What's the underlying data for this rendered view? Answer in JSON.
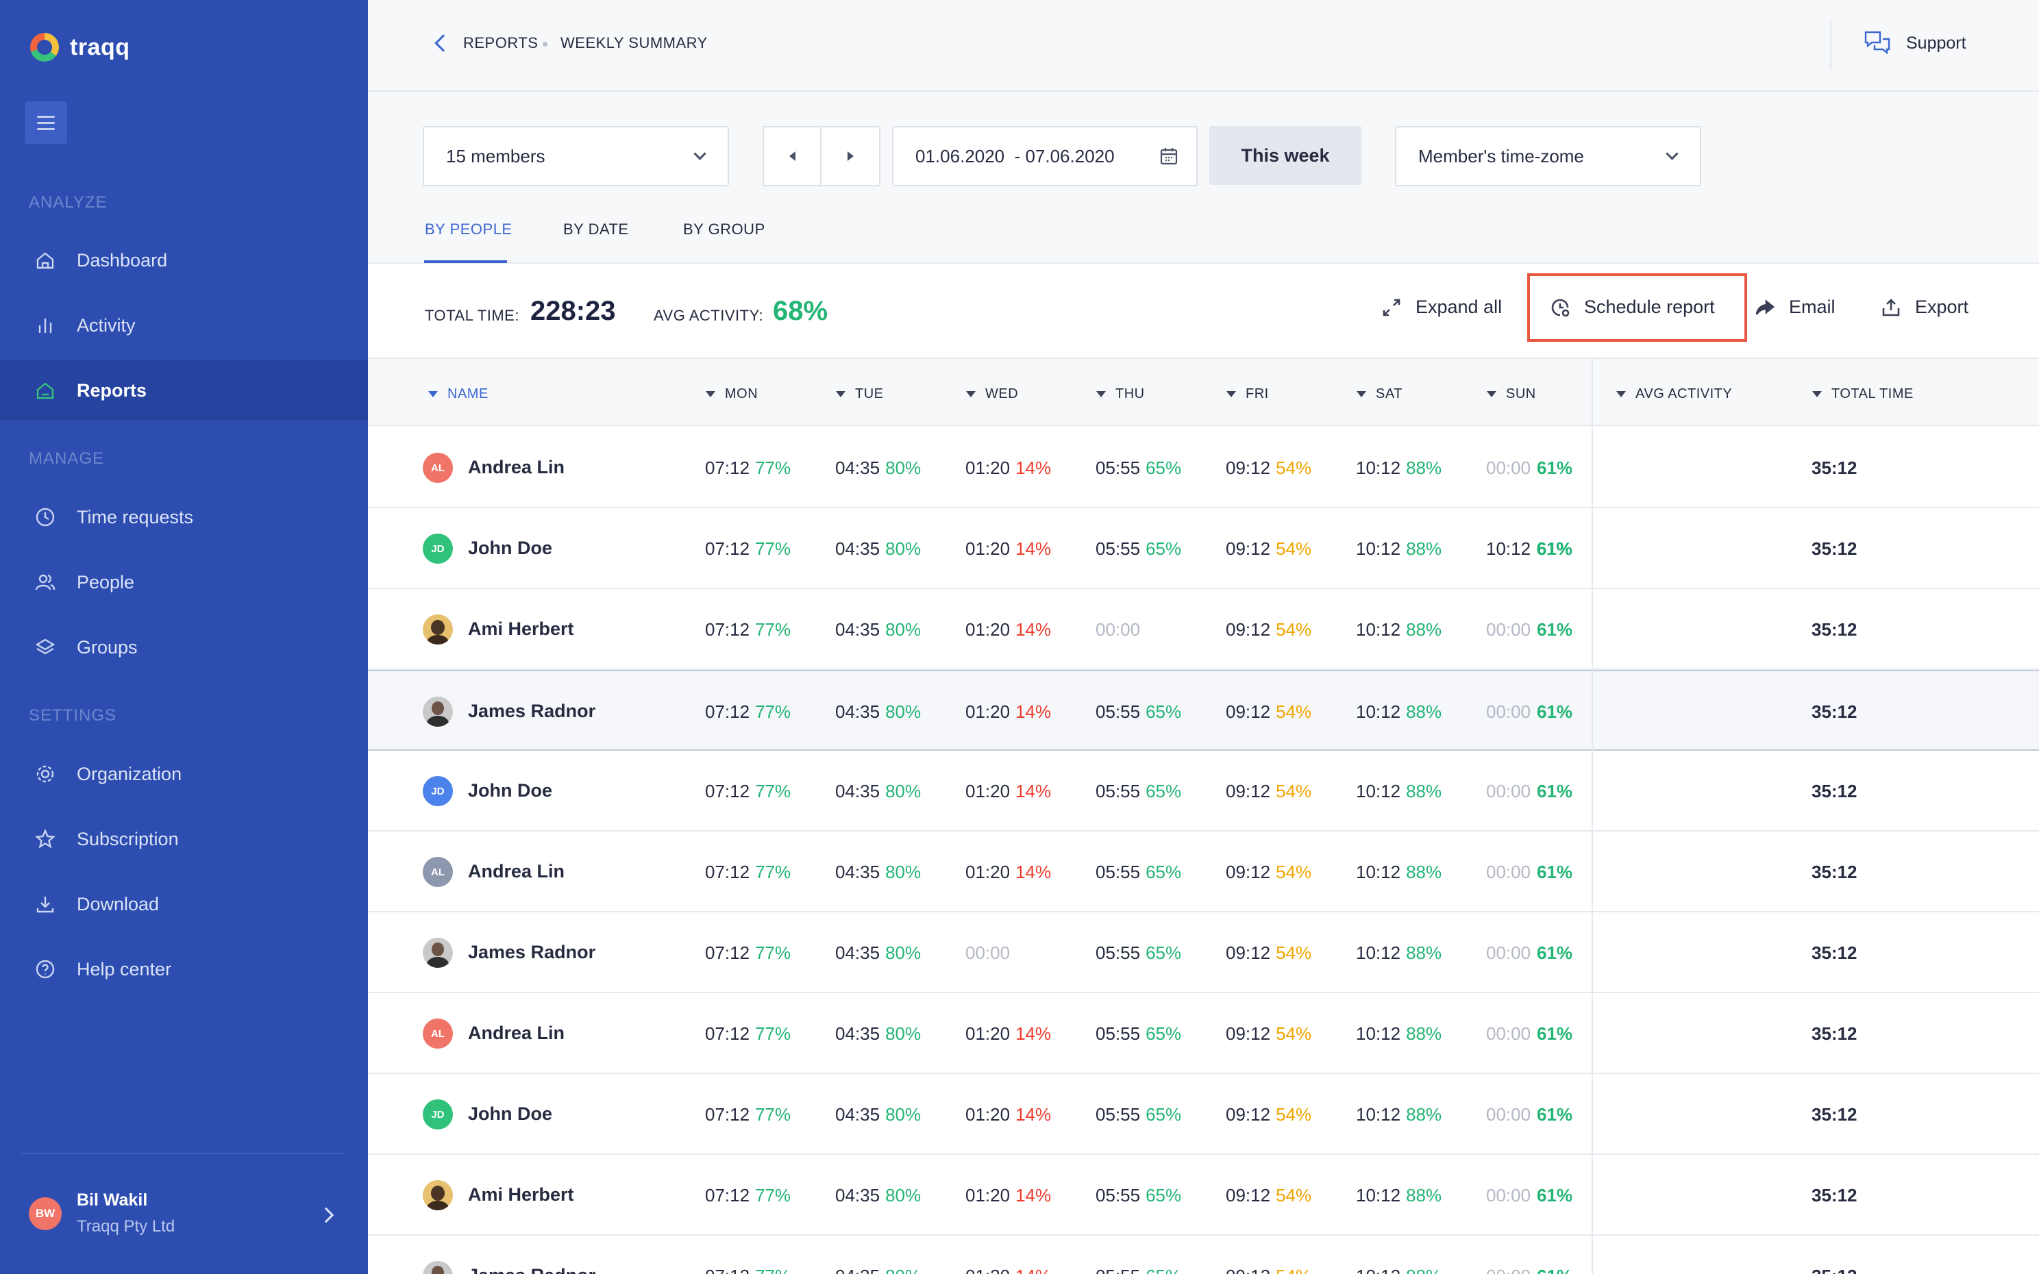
{
  "app": {
    "name": "traqq"
  },
  "sidebar": {
    "sections": [
      "ANALYZE",
      "MANAGE",
      "SETTINGS"
    ],
    "items": [
      {
        "label": "Dashboard",
        "icon": "home-icon"
      },
      {
        "label": "Activity",
        "icon": "bar-chart-icon"
      },
      {
        "label": "Reports",
        "icon": "reports-icon",
        "active": true
      },
      {
        "label": "Time requests",
        "icon": "clock-icon"
      },
      {
        "label": "People",
        "icon": "people-icon"
      },
      {
        "label": "Groups",
        "icon": "layers-icon"
      },
      {
        "label": "Organization",
        "icon": "gear-icon"
      },
      {
        "label": "Subscription",
        "icon": "star-icon"
      },
      {
        "label": "Download",
        "icon": "download-icon"
      },
      {
        "label": "Help center",
        "icon": "help-icon"
      }
    ],
    "user": {
      "initials": "BW",
      "name": "Bil Wakil",
      "org": "Traqq Pty Ltd"
    }
  },
  "header": {
    "breadcrumb": [
      "REPORTS",
      "WEEKLY SUMMARY"
    ],
    "support_label": "Support"
  },
  "filters": {
    "members": "15 members",
    "date_range": "01.06.2020  - 07.06.2020",
    "this_week": "This week",
    "timezone": "Member's time-zome"
  },
  "tabs": [
    "BY PEOPLE",
    "BY DATE",
    "BY GROUP"
  ],
  "summary": {
    "total_label": "TOTAL TIME:",
    "total_value": "228:23",
    "avg_label": "AVG ACTIVITY:",
    "avg_value": "68%"
  },
  "actions": {
    "expand_all": "Expand all",
    "schedule_report": "Schedule report",
    "email": "Email",
    "export": "Export"
  },
  "table": {
    "columns": [
      "NAME",
      "MON",
      "TUE",
      "WED",
      "THU",
      "FRI",
      "SAT",
      "SUN",
      "AVG ACTIVITY",
      "TOTAL TIME"
    ],
    "rows": [
      {
        "name": "Andrea Lin",
        "initials": "AL",
        "avatar_color": "#f07468",
        "days": [
          [
            "07:12",
            "77%"
          ],
          [
            "04:35",
            "80%"
          ],
          [
            "01:20",
            "14%"
          ],
          [
            "05:55",
            "65%"
          ],
          [
            "09:12",
            "54%"
          ],
          [
            "10:12",
            "88%"
          ],
          [
            "00:00",
            ""
          ]
        ],
        "avg": "61%",
        "total": "35:12"
      },
      {
        "name": "John Doe",
        "initials": "JD",
        "avatar_color": "#30c27b",
        "days": [
          [
            "07:12",
            "77%"
          ],
          [
            "04:35",
            "80%"
          ],
          [
            "01:20",
            "14%"
          ],
          [
            "05:55",
            "65%"
          ],
          [
            "09:12",
            "54%"
          ],
          [
            "10:12",
            "88%"
          ],
          [
            "10:12",
            "61%"
          ]
        ],
        "avg": "61%",
        "total": "35:12"
      },
      {
        "name": "Ami Herbert",
        "initials": "",
        "avatar_color": "photo",
        "days": [
          [
            "07:12",
            "77%"
          ],
          [
            "04:35",
            "80%"
          ],
          [
            "01:20",
            "14%"
          ],
          [
            "00:00",
            ""
          ],
          [
            "09:12",
            "54%"
          ],
          [
            "10:12",
            "88%"
          ],
          [
            "00:00",
            ""
          ]
        ],
        "avg": "61%",
        "total": "35:12"
      },
      {
        "name": "James Radnor",
        "initials": "",
        "avatar_color": "photo2",
        "days": [
          [
            "07:12",
            "77%"
          ],
          [
            "04:35",
            "80%"
          ],
          [
            "01:20",
            "14%"
          ],
          [
            "05:55",
            "65%"
          ],
          [
            "09:12",
            "54%"
          ],
          [
            "10:12",
            "88%"
          ],
          [
            "00:00",
            ""
          ]
        ],
        "avg": "61%",
        "total": "35:12"
      },
      {
        "name": "John Doe",
        "initials": "JD",
        "avatar_color": "#4b82ec",
        "days": [
          [
            "07:12",
            "77%"
          ],
          [
            "04:35",
            "80%"
          ],
          [
            "01:20",
            "14%"
          ],
          [
            "05:55",
            "65%"
          ],
          [
            "09:12",
            "54%"
          ],
          [
            "10:12",
            "88%"
          ],
          [
            "00:00",
            ""
          ]
        ],
        "avg": "61%",
        "total": "35:12"
      },
      {
        "name": "Andrea Lin",
        "initials": "AL",
        "avatar_color": "#8d97ad",
        "days": [
          [
            "07:12",
            "77%"
          ],
          [
            "04:35",
            "80%"
          ],
          [
            "01:20",
            "14%"
          ],
          [
            "05:55",
            "65%"
          ],
          [
            "09:12",
            "54%"
          ],
          [
            "10:12",
            "88%"
          ],
          [
            "00:00",
            ""
          ]
        ],
        "avg": "61%",
        "total": "35:12"
      },
      {
        "name": "James Radnor",
        "initials": "",
        "avatar_color": "photo2",
        "days": [
          [
            "07:12",
            "77%"
          ],
          [
            "04:35",
            "80%"
          ],
          [
            "00:00",
            ""
          ],
          [
            "05:55",
            "65%"
          ],
          [
            "09:12",
            "54%"
          ],
          [
            "10:12",
            "88%"
          ],
          [
            "00:00",
            ""
          ]
        ],
        "avg": "61%",
        "total": "35:12"
      },
      {
        "name": "Andrea Lin",
        "initials": "AL",
        "avatar_color": "#f07468",
        "days": [
          [
            "07:12",
            "77%"
          ],
          [
            "04:35",
            "80%"
          ],
          [
            "01:20",
            "14%"
          ],
          [
            "05:55",
            "65%"
          ],
          [
            "09:12",
            "54%"
          ],
          [
            "10:12",
            "88%"
          ],
          [
            "00:00",
            ""
          ]
        ],
        "avg": "61%",
        "total": "35:12"
      },
      {
        "name": "John Doe",
        "initials": "JD",
        "avatar_color": "#30c27b",
        "days": [
          [
            "07:12",
            "77%"
          ],
          [
            "04:35",
            "80%"
          ],
          [
            "01:20",
            "14%"
          ],
          [
            "05:55",
            "65%"
          ],
          [
            "09:12",
            "54%"
          ],
          [
            "10:12",
            "88%"
          ],
          [
            "00:00",
            ""
          ]
        ],
        "avg": "61%",
        "total": "35:12"
      },
      {
        "name": "Ami Herbert",
        "initials": "",
        "avatar_color": "photo",
        "days": [
          [
            "07:12",
            "77%"
          ],
          [
            "04:35",
            "80%"
          ],
          [
            "01:20",
            "14%"
          ],
          [
            "05:55",
            "65%"
          ],
          [
            "09:12",
            "54%"
          ],
          [
            "10:12",
            "88%"
          ],
          [
            "00:00",
            ""
          ]
        ],
        "avg": "61%",
        "total": "35:12"
      },
      {
        "name": "James Radnor",
        "initials": "",
        "avatar_color": "photo2",
        "days": [
          [
            "07:12",
            "77%"
          ],
          [
            "04:35",
            "80%"
          ],
          [
            "01:20",
            "14%"
          ],
          [
            "05:55",
            "65%"
          ],
          [
            "09:12",
            "54%"
          ],
          [
            "10:12",
            "88%"
          ],
          [
            "00:00",
            ""
          ]
        ],
        "avg": "61%",
        "total": "35:12"
      }
    ]
  },
  "colors": {
    "sidebar": "#2d4eb0",
    "accent": "#3b66d1",
    "green": "#23b574",
    "red": "#ee3b2b",
    "yellow": "#f0a500",
    "highlight": "#e8573f"
  }
}
